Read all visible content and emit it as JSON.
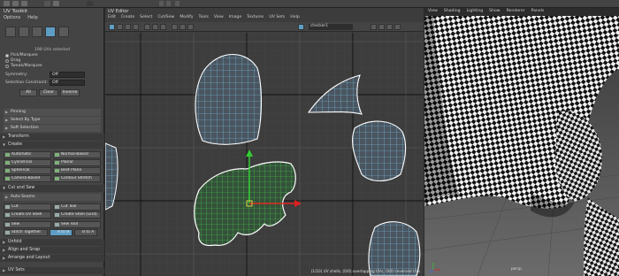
{
  "toolkit": {
    "title": "UV Toolkit",
    "menu": [
      "Options",
      "Help"
    ],
    "uv_count": "198 UVs selected",
    "selection_modes": [
      "Pick/Marquee",
      "Drag",
      "Tweak/Marquee"
    ],
    "symmetry": {
      "label": "Symmetry:",
      "value": "Off"
    },
    "constraint": {
      "label": "Selection Constraint:",
      "value": "Off"
    },
    "select_buttons": [
      "All",
      "Clear",
      "Inverse"
    ],
    "subsections": [
      "Pinning",
      "Select By Type",
      "Soft Selection"
    ],
    "transform_label": "Transform",
    "create_label": "Create",
    "create_buttons": [
      "Automatic",
      "Normal-Based",
      "Cylindrical",
      "Planar",
      "Spherical",
      "Best Plane",
      "Camera-Based",
      "Contour Stretch"
    ],
    "cut_sew_label": "Cut and Sew",
    "auto_seams": "Auto Seams",
    "cut_buttons": [
      "Cut",
      "Cut Tool",
      "Create UV Shell",
      "Create Shell (Grid)"
    ],
    "sew_buttons": [
      "Sew",
      "Sew Tool",
      "Stitch Together",
      "A to B",
      "B to A"
    ],
    "bottom_sections": [
      "Unfold",
      "Align and Snap",
      "Arrange and Layout",
      "UV Sets"
    ]
  },
  "uv_editor": {
    "title": "UV Editor",
    "menu": [
      "Edit",
      "Create",
      "Select",
      "Cut/Sew",
      "Modify",
      "Tools",
      "View",
      "Image",
      "Textures",
      "UV Sets",
      "Help"
    ],
    "texture_field": "checker1",
    "status": "(1/10) UV shells, (0/0) overlapping UVs, (0/0) reversed UVs"
  },
  "viewport": {
    "menu": [
      "View",
      "Shading",
      "Lighting",
      "Show",
      "Renderer",
      "Panels"
    ],
    "camera_label": "persp"
  },
  "colors": {
    "uv_wire": "#7ec8e8",
    "uv_selected": "#4ed24e",
    "axis_y": "#33cc33",
    "axis_x": "#e02020",
    "accent": "#5f9ec4"
  }
}
